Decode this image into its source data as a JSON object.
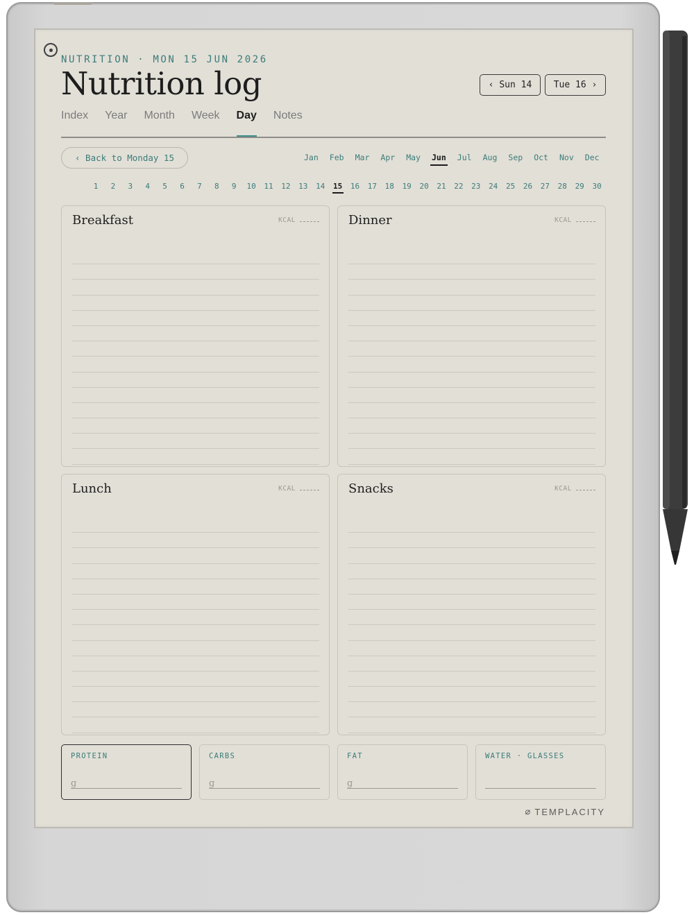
{
  "header": {
    "eyebrow": "NUTRITION · MON 15 JUN 2026",
    "title": "Nutrition log",
    "prev_day": "‹ Sun 14",
    "next_day": "Tue 16 ›"
  },
  "tabs": [
    {
      "label": "Index",
      "active": false
    },
    {
      "label": "Year",
      "active": false
    },
    {
      "label": "Month",
      "active": false
    },
    {
      "label": "Week",
      "active": false
    },
    {
      "label": "Day",
      "active": true
    },
    {
      "label": "Notes",
      "active": false
    }
  ],
  "back_button": "‹ Back to Monday 15",
  "months": [
    "Jan",
    "Feb",
    "Mar",
    "Apr",
    "May",
    "Jun",
    "Jul",
    "Aug",
    "Sep",
    "Oct",
    "Nov",
    "Dec"
  ],
  "active_month": "Jun",
  "days": [
    "1",
    "2",
    "3",
    "4",
    "5",
    "6",
    "7",
    "8",
    "9",
    "10",
    "11",
    "12",
    "13",
    "14",
    "15",
    "16",
    "17",
    "18",
    "19",
    "20",
    "21",
    "22",
    "23",
    "24",
    "25",
    "26",
    "27",
    "28",
    "29",
    "30"
  ],
  "active_day": "15",
  "meals": [
    {
      "title": "Breakfast",
      "kcal_label": "KCAL"
    },
    {
      "title": "Dinner",
      "kcal_label": "KCAL"
    },
    {
      "title": "Lunch",
      "kcal_label": "KCAL"
    },
    {
      "title": "Snacks",
      "kcal_label": "KCAL"
    }
  ],
  "macros": [
    {
      "label": "PROTEIN",
      "unit": "g"
    },
    {
      "label": "CARBS",
      "unit": "g"
    },
    {
      "label": "FAT",
      "unit": "g"
    },
    {
      "label": "WATER · GLASSES",
      "unit": ""
    }
  ],
  "brand": "TEMPLACITY",
  "colors": {
    "accent": "#3a7c78",
    "paper": "#e2dfd7",
    "ink": "#1e1e1e"
  }
}
